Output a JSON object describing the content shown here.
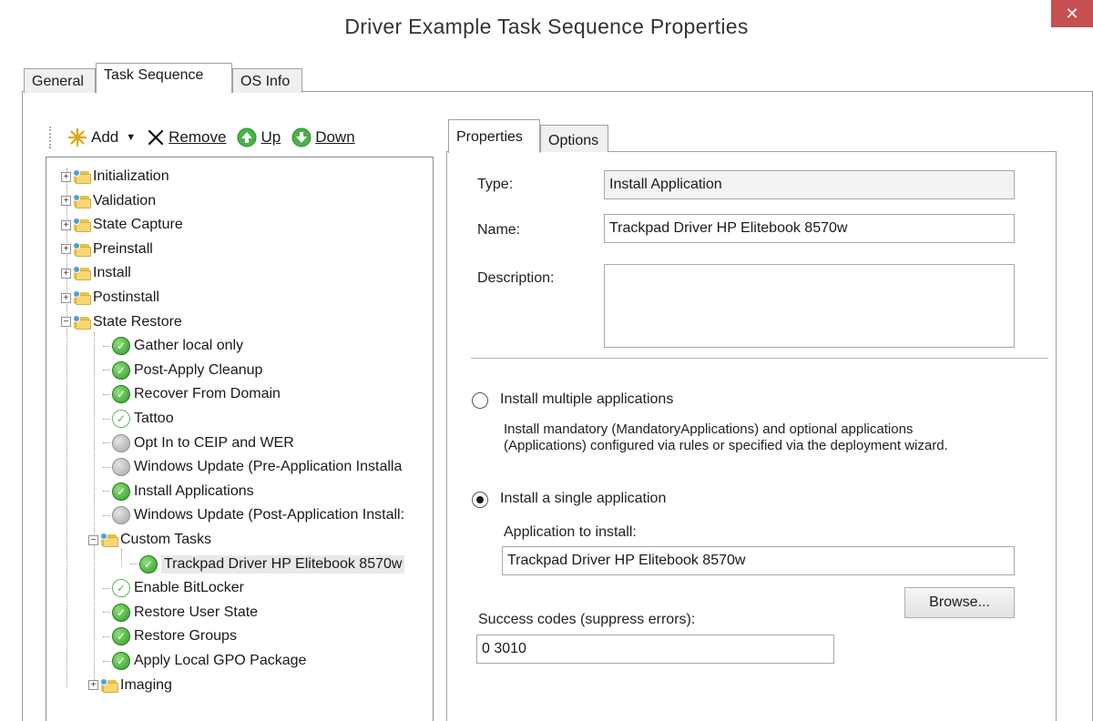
{
  "window": {
    "title": "Driver Example Task Sequence Properties",
    "close_glyph": "✕"
  },
  "outer_tabs": [
    {
      "label": "General"
    },
    {
      "label": "Task Sequence"
    },
    {
      "label": "OS Info"
    }
  ],
  "toolbar": {
    "add": "Add",
    "remove": "Remove",
    "up": "Up",
    "down": "Down",
    "icons": [
      "add-star-icon",
      "dropdown-arrow-icon",
      "remove-x-icon",
      "up-arrow-icon",
      "down-arrow-icon"
    ]
  },
  "tree": {
    "items": [
      {
        "label": "Initialization",
        "kind": "folder",
        "expanded": false
      },
      {
        "label": "Validation",
        "kind": "folder",
        "expanded": false
      },
      {
        "label": "State Capture",
        "kind": "folder",
        "expanded": false
      },
      {
        "label": "Preinstall",
        "kind": "folder",
        "expanded": false
      },
      {
        "label": "Install",
        "kind": "folder",
        "expanded": false
      },
      {
        "label": "Postinstall",
        "kind": "folder",
        "expanded": false
      },
      {
        "label": "State Restore",
        "kind": "folder",
        "expanded": true
      },
      {
        "label": "Gather local only",
        "kind": "step",
        "status": "green"
      },
      {
        "label": "Post-Apply Cleanup",
        "kind": "step",
        "status": "green"
      },
      {
        "label": "Recover From Domain",
        "kind": "step",
        "status": "green"
      },
      {
        "label": "Tattoo",
        "kind": "step",
        "status": "outline"
      },
      {
        "label": "Opt In to CEIP and WER",
        "kind": "step",
        "status": "gray"
      },
      {
        "label": "Windows Update (Pre-Application Installa",
        "kind": "step",
        "status": "gray"
      },
      {
        "label": "Install Applications",
        "kind": "step",
        "status": "green"
      },
      {
        "label": "Windows Update (Post-Application Install:",
        "kind": "step",
        "status": "gray"
      },
      {
        "label": "Custom Tasks",
        "kind": "folder",
        "expanded": true
      },
      {
        "label": "Trackpad Driver HP Elitebook 8570w",
        "kind": "step",
        "status": "green",
        "selected": true
      },
      {
        "label": "Enable BitLocker",
        "kind": "step",
        "status": "outline"
      },
      {
        "label": "Restore User State",
        "kind": "step",
        "status": "green"
      },
      {
        "label": "Restore Groups",
        "kind": "step",
        "status": "green"
      },
      {
        "label": "Apply Local GPO Package",
        "kind": "step",
        "status": "green"
      },
      {
        "label": "Imaging",
        "kind": "folder",
        "expanded": false
      }
    ]
  },
  "inner_tabs": [
    {
      "label": "Properties"
    },
    {
      "label": "Options"
    }
  ],
  "properties": {
    "type_label": "Type:",
    "type_value": "Install Application",
    "name_label": "Name:",
    "name_value": "Trackpad Driver HP Elitebook 8570w",
    "description_label": "Description:",
    "description_value": "",
    "radio_multiple_label": "Install multiple applications",
    "radio_multiple_checked": false,
    "multiple_description": "Install mandatory (MandatoryApplications) and optional applications (Applications) configured via rules or specified via the deployment wizard.",
    "radio_single_label": "Install a single application",
    "radio_single_checked": true,
    "app_to_install_label": "Application to install:",
    "app_to_install_value": "Trackpad Driver HP Elitebook 8570w",
    "browse_label": "Browse...",
    "success_codes_label": "Success codes (suppress errors):",
    "success_codes_value": "0 3010"
  }
}
